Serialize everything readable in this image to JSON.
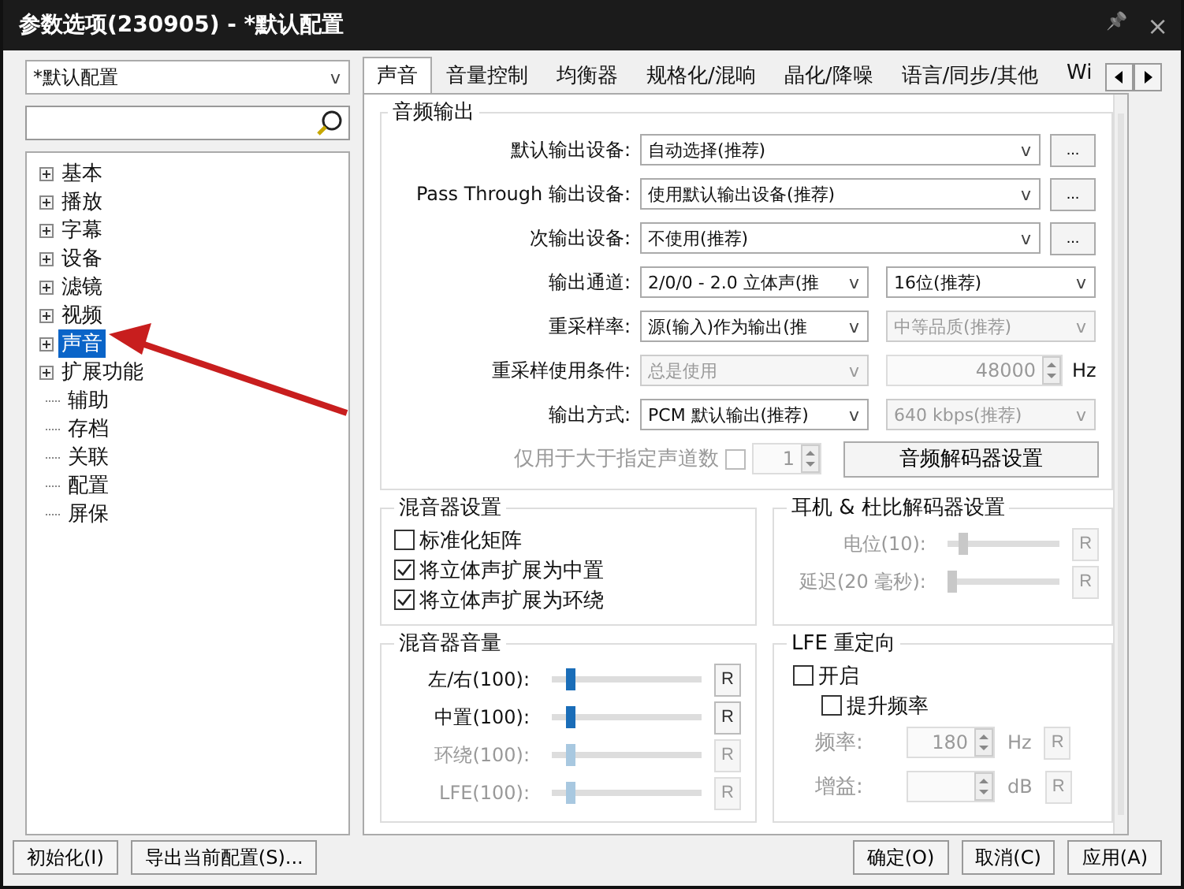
{
  "window": {
    "title": "参数选项(230905) - *默认配置",
    "pin": "📌",
    "close": "×"
  },
  "profile_select": {
    "value": "*默认配置",
    "caret": "v"
  },
  "tree": [
    {
      "label": "基本",
      "expandable": true,
      "selected": false
    },
    {
      "label": "播放",
      "expandable": true,
      "selected": false
    },
    {
      "label": "字幕",
      "expandable": true,
      "selected": false
    },
    {
      "label": "设备",
      "expandable": true,
      "selected": false
    },
    {
      "label": "滤镜",
      "expandable": true,
      "selected": false
    },
    {
      "label": "视频",
      "expandable": true,
      "selected": false
    },
    {
      "label": "声音",
      "expandable": true,
      "selected": true
    },
    {
      "label": "扩展功能",
      "expandable": true,
      "selected": false
    },
    {
      "label": "辅助",
      "expandable": false,
      "selected": false
    },
    {
      "label": "存档",
      "expandable": false,
      "selected": false
    },
    {
      "label": "关联",
      "expandable": false,
      "selected": false
    },
    {
      "label": "配置",
      "expandable": false,
      "selected": false
    },
    {
      "label": "屏保",
      "expandable": false,
      "selected": false
    }
  ],
  "annotation": {
    "kind": "arrow"
  },
  "tabs": [
    {
      "label": "声音",
      "selected": true
    },
    {
      "label": "音量控制",
      "selected": false
    },
    {
      "label": "均衡器",
      "selected": false
    },
    {
      "label": "规格化/混响",
      "selected": false
    },
    {
      "label": "晶化/降噪",
      "selected": false
    },
    {
      "label": "语言/同步/其他",
      "selected": false
    },
    {
      "label": "Wi",
      "selected": false
    }
  ],
  "audio_output": {
    "title": "音频输出",
    "rows": [
      {
        "label": "默认输出设备:",
        "controls": [
          {
            "kind": "select",
            "value": "自动选择(推荐)",
            "caret": "v",
            "disabled": false
          },
          {
            "kind": "more",
            "value": "..."
          }
        ]
      },
      {
        "label": "Pass Through 输出设备:",
        "controls": [
          {
            "kind": "select",
            "value": "使用默认输出设备(推荐)",
            "caret": "v",
            "disabled": false
          },
          {
            "kind": "more",
            "value": "..."
          }
        ]
      },
      {
        "label": "次输出设备:",
        "controls": [
          {
            "kind": "select",
            "value": "不使用(推荐)",
            "caret": "v",
            "disabled": false
          },
          {
            "kind": "more",
            "value": "..."
          }
        ]
      },
      {
        "label": "输出通道:",
        "controls": [
          {
            "kind": "select",
            "value": "2/0/0 - 2.0 立体声(推",
            "caret": "v",
            "disabled": false
          },
          {
            "kind": "select",
            "value": "16位(推荐)",
            "caret": "v",
            "disabled": false
          }
        ]
      },
      {
        "label": "重采样率:",
        "controls": [
          {
            "kind": "select",
            "value": "源(输入)作为输出(推",
            "caret": "v",
            "disabled": false
          },
          {
            "kind": "select",
            "value": "中等品质(推荐)",
            "caret": "v",
            "disabled": true
          }
        ]
      },
      {
        "label": "重采样使用条件:",
        "controls": [
          {
            "kind": "select",
            "value": "总是使用",
            "caret": "v",
            "disabled": true
          },
          {
            "kind": "spinner",
            "value": "48000",
            "unit": "Hz",
            "disabled": true
          }
        ]
      },
      {
        "label": "输出方式:",
        "controls": [
          {
            "kind": "select",
            "value": "PCM 默认输出(推荐)",
            "caret": "v",
            "disabled": false
          },
          {
            "kind": "select",
            "value": "640 kbps(推荐)",
            "caret": "v",
            "disabled": true
          }
        ]
      }
    ],
    "channel_limit": {
      "label": "仅用于大于指定声道数",
      "checked": false,
      "value": "1",
      "disabled": true
    },
    "decoder_button": "音频解码器设置"
  },
  "mixer_settings": {
    "title": "混音器设置",
    "options": [
      {
        "label": "标准化矩阵",
        "checked": false
      },
      {
        "label": "将立体声扩展为中置",
        "checked": true
      },
      {
        "label": "将立体声扩展为环绕",
        "checked": true
      }
    ]
  },
  "headphone": {
    "title": "耳机 & 杜比解码器设置",
    "sliders": [
      {
        "label": "电位(10):",
        "level": 0.1,
        "disabled": true,
        "reset": "R"
      },
      {
        "label": "延迟(20 毫秒):",
        "level": 0.0,
        "disabled": true,
        "reset": "R"
      }
    ]
  },
  "mixer_volume": {
    "title": "混音器音量",
    "sliders": [
      {
        "label": "左/右(100):",
        "level": 0.1,
        "disabled": false,
        "reset": "R"
      },
      {
        "label": "中置(100):",
        "level": 0.1,
        "disabled": false,
        "reset": "R"
      },
      {
        "label": "环绕(100):",
        "level": 0.1,
        "disabled": true,
        "reset": "R"
      },
      {
        "label": "LFE(100):",
        "level": 0.1,
        "disabled": true,
        "reset": "R"
      }
    ]
  },
  "lfe": {
    "title": "LFE 重定向",
    "options": [
      {
        "label": "开启",
        "checked": false,
        "children": [
          {
            "label": "提升频率",
            "checked": false
          }
        ]
      }
    ],
    "fields": [
      {
        "label": "频率:",
        "value": "180",
        "unit": "Hz",
        "reset": "R",
        "disabled": true
      },
      {
        "label": "增益:",
        "unit": "dB",
        "reset": "R",
        "disabled": true
      }
    ]
  },
  "footer": {
    "left_buttons": [
      "初始化(I)",
      "导出当前配置(S)..."
    ],
    "right_buttons": [
      "确定(O)",
      "取消(C)",
      "应用(A)"
    ]
  }
}
